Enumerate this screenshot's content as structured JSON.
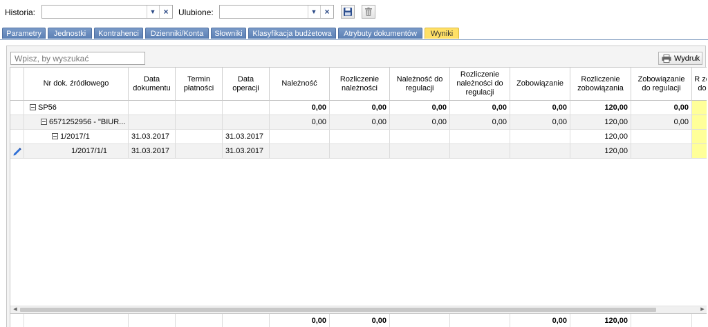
{
  "toolbar": {
    "history_label": "Historia:",
    "favorites_label": "Ulubione:",
    "history_value": "",
    "favorites_value": ""
  },
  "tabs": [
    {
      "label": "Parametry"
    },
    {
      "label": "Jednostki"
    },
    {
      "label": "Kontrahenci"
    },
    {
      "label": "Dzienniki/Konta"
    },
    {
      "label": "Słowniki"
    },
    {
      "label": "Klasyfikacja budżetowa"
    },
    {
      "label": "Atrybuty dokumentów"
    },
    {
      "label": "Wyniki",
      "active": true
    }
  ],
  "search": {
    "placeholder": "Wpisz, by wyszukać"
  },
  "print_label": "Wydruk",
  "columns": [
    {
      "label": ""
    },
    {
      "label": "Nr dok. źródłowego"
    },
    {
      "label": "Data dokumentu"
    },
    {
      "label": "Termin płatności"
    },
    {
      "label": "Data operacji"
    },
    {
      "label": "Należność"
    },
    {
      "label": "Rozliczenie należności"
    },
    {
      "label": "Należność do regulacji"
    },
    {
      "label": "Rozliczenie należności do regulacji"
    },
    {
      "label": "Zobowiązanie"
    },
    {
      "label": "Rozliczenie zobowiązania"
    },
    {
      "label": "Zobowiązanie do regulacji"
    },
    {
      "label": "R zo do"
    }
  ],
  "rows": [
    {
      "name": "SP56",
      "data_dok": "",
      "termin": "",
      "data_op": "",
      "naleznosc": "0,00",
      "rozl_nal": "0,00",
      "nal_do_reg": "0,00",
      "rozl_nal_do_reg": "0,00",
      "zobowiazanie": "0,00",
      "rozl_zob": "120,00",
      "zob_do_reg": "0,00"
    },
    {
      "name": "6571252956 - \"BIUR...",
      "data_dok": "",
      "termin": "",
      "data_op": "",
      "naleznosc": "0,00",
      "rozl_nal": "0,00",
      "nal_do_reg": "0,00",
      "rozl_nal_do_reg": "0,00",
      "zobowiazanie": "0,00",
      "rozl_zob": "120,00",
      "zob_do_reg": "0,00"
    },
    {
      "name": "1/2017/1",
      "data_dok": "31.03.2017",
      "termin": "",
      "data_op": "31.03.2017",
      "naleznosc": "",
      "rozl_nal": "",
      "nal_do_reg": "",
      "rozl_nal_do_reg": "",
      "zobowiazanie": "",
      "rozl_zob": "120,00",
      "zob_do_reg": ""
    },
    {
      "name": "1/2017/1/1",
      "data_dok": "31.03.2017",
      "termin": "",
      "data_op": "31.03.2017",
      "naleznosc": "",
      "rozl_nal": "",
      "nal_do_reg": "",
      "rozl_nal_do_reg": "",
      "zobowiazanie": "",
      "rozl_zob": "120,00",
      "zob_do_reg": ""
    }
  ],
  "totals": {
    "naleznosc": "0,00",
    "rozl_nal": "0,00",
    "zobowiazanie": "0,00",
    "rozl_zob": "120,00"
  },
  "colors": {
    "tab": "#6688bb",
    "tab_active": "#ffe066",
    "highlight": "#ffff99"
  },
  "icons": [
    "chevron-down-icon",
    "close-icon",
    "save-icon",
    "trash-icon",
    "printer-icon",
    "pencil-icon",
    "collapse-icon"
  ]
}
